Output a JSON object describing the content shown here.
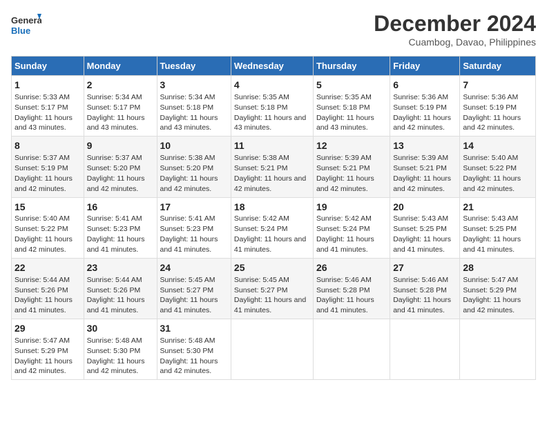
{
  "logo": {
    "line1": "General",
    "line2": "Blue"
  },
  "title": "December 2024",
  "subtitle": "Cuambog, Davao, Philippines",
  "columns": [
    "Sunday",
    "Monday",
    "Tuesday",
    "Wednesday",
    "Thursday",
    "Friday",
    "Saturday"
  ],
  "weeks": [
    [
      {
        "day": "1",
        "sunrise": "5:33 AM",
        "sunset": "5:17 PM",
        "daylight": "11 hours and 43 minutes."
      },
      {
        "day": "2",
        "sunrise": "5:34 AM",
        "sunset": "5:17 PM",
        "daylight": "11 hours and 43 minutes."
      },
      {
        "day": "3",
        "sunrise": "5:34 AM",
        "sunset": "5:18 PM",
        "daylight": "11 hours and 43 minutes."
      },
      {
        "day": "4",
        "sunrise": "5:35 AM",
        "sunset": "5:18 PM",
        "daylight": "11 hours and 43 minutes."
      },
      {
        "day": "5",
        "sunrise": "5:35 AM",
        "sunset": "5:18 PM",
        "daylight": "11 hours and 43 minutes."
      },
      {
        "day": "6",
        "sunrise": "5:36 AM",
        "sunset": "5:19 PM",
        "daylight": "11 hours and 42 minutes."
      },
      {
        "day": "7",
        "sunrise": "5:36 AM",
        "sunset": "5:19 PM",
        "daylight": "11 hours and 42 minutes."
      }
    ],
    [
      {
        "day": "8",
        "sunrise": "5:37 AM",
        "sunset": "5:19 PM",
        "daylight": "11 hours and 42 minutes."
      },
      {
        "day": "9",
        "sunrise": "5:37 AM",
        "sunset": "5:20 PM",
        "daylight": "11 hours and 42 minutes."
      },
      {
        "day": "10",
        "sunrise": "5:38 AM",
        "sunset": "5:20 PM",
        "daylight": "11 hours and 42 minutes."
      },
      {
        "day": "11",
        "sunrise": "5:38 AM",
        "sunset": "5:21 PM",
        "daylight": "11 hours and 42 minutes."
      },
      {
        "day": "12",
        "sunrise": "5:39 AM",
        "sunset": "5:21 PM",
        "daylight": "11 hours and 42 minutes."
      },
      {
        "day": "13",
        "sunrise": "5:39 AM",
        "sunset": "5:21 PM",
        "daylight": "11 hours and 42 minutes."
      },
      {
        "day": "14",
        "sunrise": "5:40 AM",
        "sunset": "5:22 PM",
        "daylight": "11 hours and 42 minutes."
      }
    ],
    [
      {
        "day": "15",
        "sunrise": "5:40 AM",
        "sunset": "5:22 PM",
        "daylight": "11 hours and 42 minutes."
      },
      {
        "day": "16",
        "sunrise": "5:41 AM",
        "sunset": "5:23 PM",
        "daylight": "11 hours and 41 minutes."
      },
      {
        "day": "17",
        "sunrise": "5:41 AM",
        "sunset": "5:23 PM",
        "daylight": "11 hours and 41 minutes."
      },
      {
        "day": "18",
        "sunrise": "5:42 AM",
        "sunset": "5:24 PM",
        "daylight": "11 hours and 41 minutes."
      },
      {
        "day": "19",
        "sunrise": "5:42 AM",
        "sunset": "5:24 PM",
        "daylight": "11 hours and 41 minutes."
      },
      {
        "day": "20",
        "sunrise": "5:43 AM",
        "sunset": "5:25 PM",
        "daylight": "11 hours and 41 minutes."
      },
      {
        "day": "21",
        "sunrise": "5:43 AM",
        "sunset": "5:25 PM",
        "daylight": "11 hours and 41 minutes."
      }
    ],
    [
      {
        "day": "22",
        "sunrise": "5:44 AM",
        "sunset": "5:26 PM",
        "daylight": "11 hours and 41 minutes."
      },
      {
        "day": "23",
        "sunrise": "5:44 AM",
        "sunset": "5:26 PM",
        "daylight": "11 hours and 41 minutes."
      },
      {
        "day": "24",
        "sunrise": "5:45 AM",
        "sunset": "5:27 PM",
        "daylight": "11 hours and 41 minutes."
      },
      {
        "day": "25",
        "sunrise": "5:45 AM",
        "sunset": "5:27 PM",
        "daylight": "11 hours and 41 minutes."
      },
      {
        "day": "26",
        "sunrise": "5:46 AM",
        "sunset": "5:28 PM",
        "daylight": "11 hours and 41 minutes."
      },
      {
        "day": "27",
        "sunrise": "5:46 AM",
        "sunset": "5:28 PM",
        "daylight": "11 hours and 41 minutes."
      },
      {
        "day": "28",
        "sunrise": "5:47 AM",
        "sunset": "5:29 PM",
        "daylight": "11 hours and 42 minutes."
      }
    ],
    [
      {
        "day": "29",
        "sunrise": "5:47 AM",
        "sunset": "5:29 PM",
        "daylight": "11 hours and 42 minutes."
      },
      {
        "day": "30",
        "sunrise": "5:48 AM",
        "sunset": "5:30 PM",
        "daylight": "11 hours and 42 minutes."
      },
      {
        "day": "31",
        "sunrise": "5:48 AM",
        "sunset": "5:30 PM",
        "daylight": "11 hours and 42 minutes."
      },
      null,
      null,
      null,
      null
    ]
  ]
}
